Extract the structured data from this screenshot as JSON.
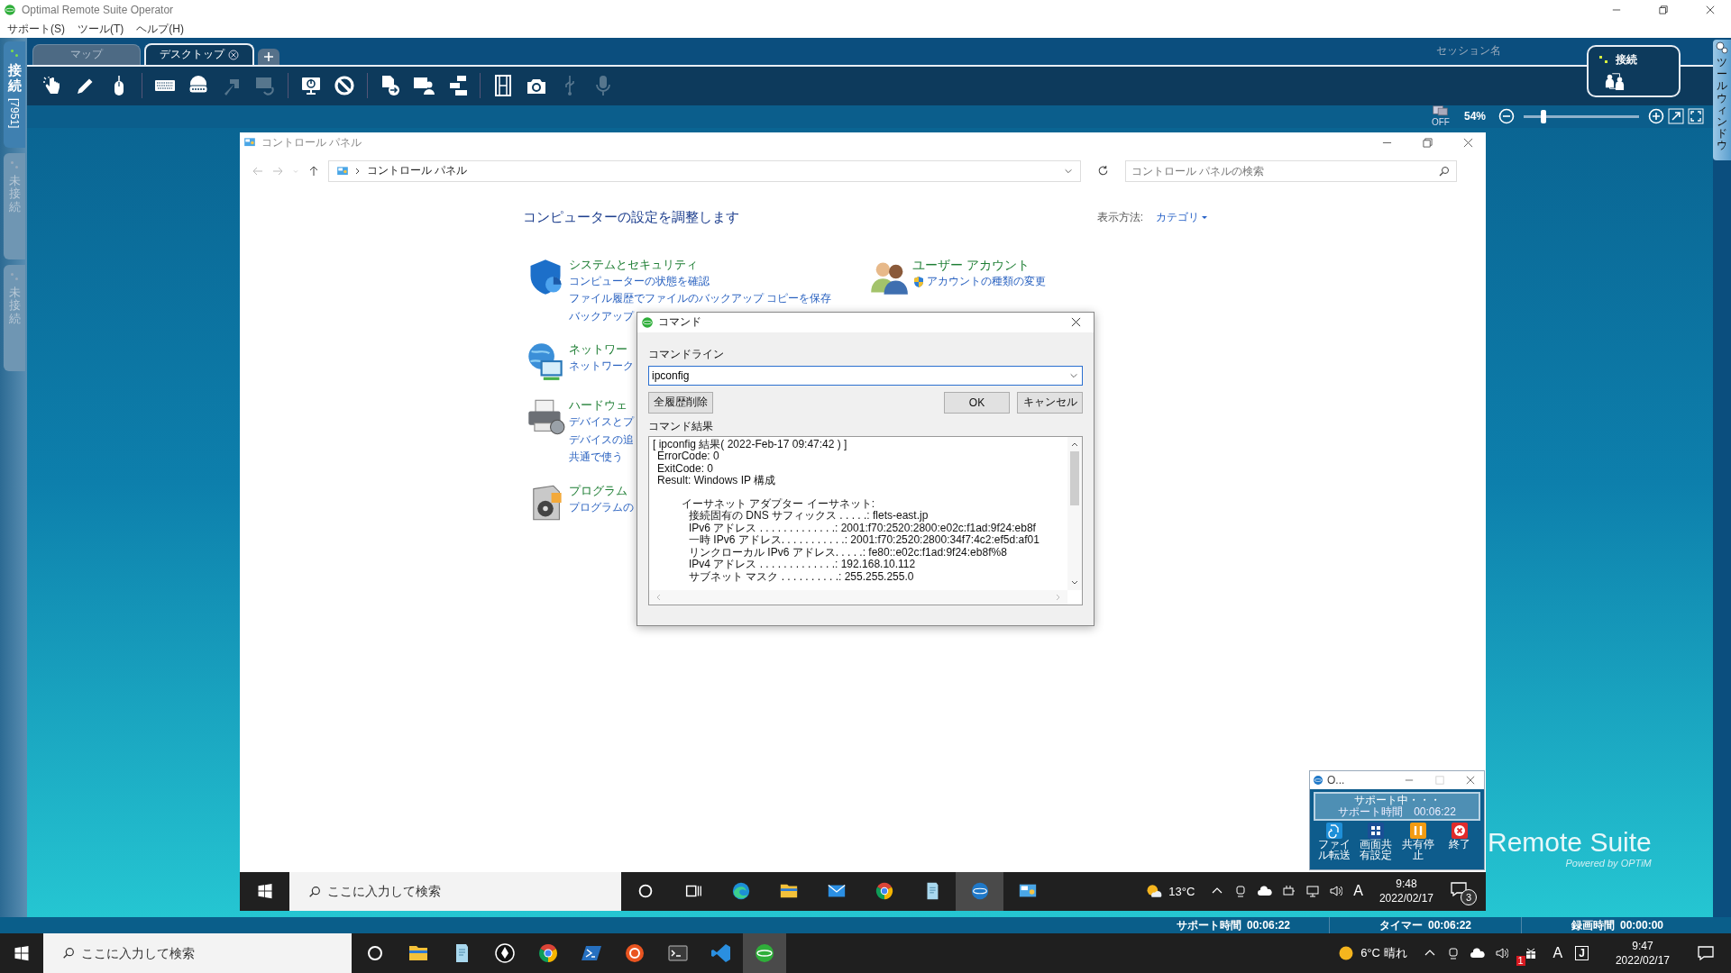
{
  "app_window": {
    "title": "Optimal Remote Suite Operator"
  },
  "menu": [
    "サポート(S)",
    "ツール(T)",
    "ヘルプ(H)"
  ],
  "session_tabs": [
    {
      "label": "接続",
      "number": "[7951]",
      "selected": true
    },
    {
      "label": "未接続",
      "selected": false
    },
    {
      "label": "未接続",
      "selected": false
    }
  ],
  "view_tabs": [
    {
      "label": "マップ",
      "selected": false,
      "closable": false
    },
    {
      "label": "デスクトップ",
      "selected": true,
      "closable": true
    }
  ],
  "session_name": "セッション名",
  "connection": {
    "label": "接続"
  },
  "toolbar": [
    [
      {
        "disabled": false
      },
      {
        "disabled": false
      },
      {
        "disabled": false
      }
    ],
    [
      {
        "disabled": false
      },
      {
        "disabled": false
      },
      {
        "disabled": true
      },
      {
        "disabled": true
      }
    ],
    [
      {
        "disabled": false
      },
      {
        "disabled": false
      }
    ],
    [
      {
        "disabled": false
      },
      {
        "disabled": false
      },
      {
        "disabled": false
      }
    ],
    [
      {
        "disabled": false
      },
      {
        "disabled": false
      },
      {
        "disabled": true
      },
      {
        "disabled": true
      }
    ]
  ],
  "display": {
    "label": "OFF"
  },
  "zoom": {
    "reading": "54%",
    "level": 0.17
  },
  "tool_window": {
    "label": "ツールウィンドウ"
  },
  "control_panel": {
    "title": "コントロール パネル",
    "breadcrumb": "コントロール パネル",
    "search": {
      "placeholder": "コントロール パネルの検索"
    },
    "heading": "コンピューターの設定を調整します",
    "view_by": {
      "label": "表示方法:",
      "value": "カテゴリ"
    },
    "left_categories": [
      {
        "title": "システムとセキュリティ",
        "links": [
          "コンピューターの状態を確認",
          "ファイル履歴でファイルのバックアップ コピーを保存",
          "バックアップ"
        ]
      },
      {
        "title": "ネットワー",
        "links": [
          "ネットワーク"
        ]
      },
      {
        "title": "ハードウェ",
        "links": [
          "デバイスとプ",
          "デバイスの追",
          "共通で使う"
        ]
      },
      {
        "title": "プログラム",
        "links": [
          "プログラムの"
        ]
      }
    ],
    "right_categories": [
      {
        "title": "ユーザー アカウント",
        "links": [
          "アカウントの種類の変更"
        ]
      }
    ]
  },
  "command_dialog": {
    "title": "コマンド",
    "command_label": "コマンドライン",
    "command": "ipconfig",
    "clear_button": "全履歴削除",
    "ok_button": "OK",
    "cancel_button": "キャンセル",
    "result_label": "コマンド結果",
    "result_lines": [
      {
        "kind": "header",
        "text": "[ ipconfig 結果( 2022-Feb-17 09:47:42 ) ]"
      },
      {
        "kind": "field",
        "text": "ErrorCode: 0"
      },
      {
        "kind": "field",
        "text": "ExitCode: 0"
      },
      {
        "kind": "field",
        "text": "Result: Windows IP 構成"
      },
      {
        "kind": "section",
        "text": "イーサネット アダプター イーサネット:"
      },
      {
        "kind": "entry",
        "text": "接続固有の DNS サフィックス . . . . .: flets-east.jp"
      },
      {
        "kind": "entry",
        "text": "IPv6 アドレス . . . . . . . . . . . . .: 2001:f70:2520:2800:e02c:f1ad:9f24:eb8f"
      },
      {
        "kind": "entry",
        "text": "一時 IPv6 アドレス. . . . . . . . . . .: 2001:f70:2520:2800:34f7:4c2:ef5d:af01"
      },
      {
        "kind": "entry",
        "text": "リンクローカル IPv6 アドレス. . . . .: fe80::e02c:f1ad:9f24:eb8f%8"
      },
      {
        "kind": "entry",
        "text": "IPv4 アドレス . . . . . . . . . . . . .: 192.168.10.112"
      },
      {
        "kind": "entry",
        "text": "サブネット マスク . . . . . . . . . .: 255.255.255.0"
      }
    ]
  },
  "mini_window": {
    "title": "O...",
    "status": "サポート中・・・",
    "timer": "サポート時間　00:06:22",
    "actions": [
      {
        "label": "ファイル転送"
      },
      {
        "label": "画面共有設定"
      },
      {
        "label": "共有停止"
      },
      {
        "label": "終了"
      }
    ]
  },
  "remote_taskbar": {
    "search": {
      "placeholder": "ここに入力して検索"
    },
    "apps": [
      {
        "selected": false
      },
      {
        "selected": false
      },
      {
        "selected": false
      },
      {
        "selected": false
      },
      {
        "selected": false
      },
      {
        "selected": false
      },
      {
        "selected": false
      },
      {
        "selected": true
      },
      {
        "selected": false
      }
    ],
    "weather": "13°C",
    "ime": "A",
    "time": "9:48",
    "date": "2022/02/17",
    "notifications": "3"
  },
  "backdrop": {
    "title": "Remote Suite",
    "subtitle": "Powered by OPTiM"
  },
  "status_bar": [
    {
      "label": "サポート時間",
      "value": "00:06:22"
    },
    {
      "label": "タイマー",
      "value": "00:06:22"
    },
    {
      "label": "録画時間",
      "value": "00:00:00"
    }
  ],
  "host_taskbar": {
    "search": {
      "placeholder": "ここに入力して検索"
    },
    "apps": [
      {
        "selected": false
      },
      {
        "selected": false
      },
      {
        "selected": false
      },
      {
        "selected": false
      },
      {
        "selected": false
      },
      {
        "selected": false
      },
      {
        "selected": false
      },
      {
        "selected": false
      },
      {
        "selected": false
      },
      {
        "selected": true
      }
    ],
    "weather": "6°C 晴れ",
    "tray_badge": "1",
    "ime": "A",
    "input_mode": "J",
    "time": "9:47",
    "date": "2022/02/17"
  }
}
